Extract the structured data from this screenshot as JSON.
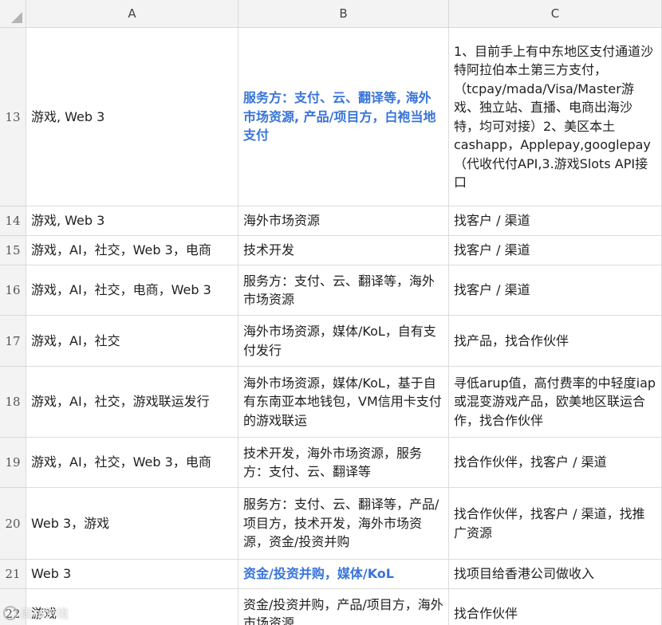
{
  "columns": [
    "A",
    "B",
    "C"
  ],
  "rows": [
    {
      "num": "13",
      "a": "游戏, Web 3",
      "b": "服务方：支付、云、翻译等, 海外市场资源, 产品/项目方，白袍当地支付",
      "c": "1、目前手上有中东地区支付通道沙特阿拉伯本土第三方支付，（tcpay/mada/Visa/Master游戏、独立站、直播、电商出海沙特，均可对接）2、美区本土cashapp，Applepay,googlepay（代收代付API,3.游戏Slots API接口",
      "b_highlight": true
    },
    {
      "num": "14",
      "a": "游戏, Web 3",
      "b": "海外市场资源",
      "c": "找客户 / 渠道"
    },
    {
      "num": "15",
      "a": "游戏，AI，社交，Web 3，电商",
      "b": "技术开发",
      "c": "找客户 / 渠道"
    },
    {
      "num": "16",
      "a": "游戏，AI，社交，电商，Web 3",
      "b": "服务方：支付、云、翻译等，海外市场资源",
      "c": "找客户 / 渠道"
    },
    {
      "num": "17",
      "a": "游戏，AI，社交",
      "b": "海外市场资源，媒体/KoL，自有支付发行",
      "c": "找产品，找合作伙伴"
    },
    {
      "num": "18",
      "a": "游戏，AI，社交，游戏联运发行",
      "b": "海外市场资源，媒体/KoL，基于自有东南亚本地钱包，VM信用卡支付的游戏联运",
      "c": "寻低arup值，高付费率的中轻度iap或混变游戏产品，欧美地区联运合作，找合作伙伴"
    },
    {
      "num": "19",
      "a": "游戏，AI，社交，Web 3，电商",
      "b": "技术开发，海外市场资源，服务方：支付、云、翻译等",
      "c": "找合作伙伴，找客户 / 渠道"
    },
    {
      "num": "20",
      "a": "Web 3，游戏",
      "b": "服务方：支付、云、翻译等，产品/项目方，技术开发，海外市场资源，资金/投资并购",
      "c": "找合作伙伴，找客户 / 渠道，找推广资源"
    },
    {
      "num": "21",
      "a": "Web 3",
      "b": "资金/投资并购，媒体/KoL",
      "c": "找项目给香港公司做收入",
      "b_highlight": true
    },
    {
      "num": "22",
      "a": "游戏",
      "b": "资金/投资并购，产品/项目方，海外市场资源",
      "c": "找合作伙伴"
    }
  ],
  "watermark": "雨林跨境",
  "colors": {
    "header_bg": "#f3f3f3",
    "grid": "#dcdcdc",
    "highlight": "#3874d8"
  }
}
